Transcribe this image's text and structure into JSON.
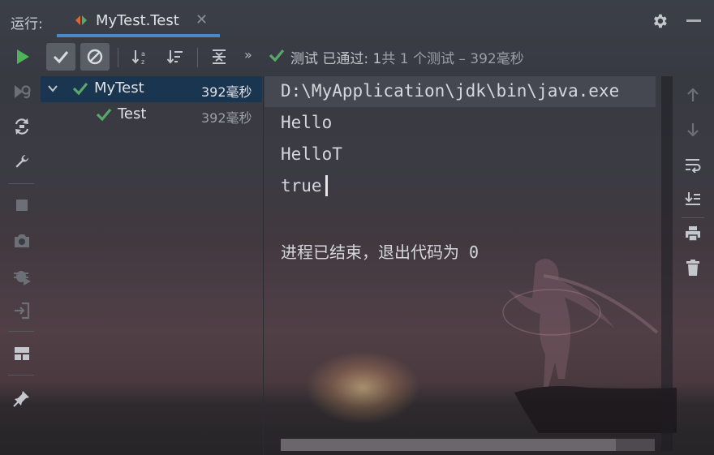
{
  "topbar": {
    "run_label": "运行:",
    "tab_title": "MyTest.Test",
    "tab_close": "✕",
    "icons": [
      "test-config-icon",
      "settings-icon",
      "minimize-icon"
    ]
  },
  "toolbar": {
    "more": "»",
    "status_main": "测试 已通过: 1",
    "status_sub": "共 1 个测试 – 392毫秒",
    "icons": [
      "run-icon",
      "show-passed-icon",
      "show-ignored-icon",
      "sort-alpha-icon",
      "sort-duration-icon",
      "expand-all-icon"
    ]
  },
  "left_strip": {
    "icons": [
      "rerun-failed-icon",
      "toggle-auto-test-icon",
      "wrench-icon",
      "stop-icon",
      "camera-icon",
      "debug-icon",
      "exit-icon",
      "layout-icon",
      "pin-icon"
    ]
  },
  "tree": {
    "items": [
      {
        "label": "MyTest",
        "time": "392毫秒",
        "status": "passed",
        "expanded": true
      },
      {
        "label": "Test",
        "time": "392毫秒",
        "status": "passed"
      }
    ]
  },
  "console": {
    "lines": [
      "D:\\MyApplication\\jdk\\bin\\java.exe",
      "Hello",
      "HelloT",
      "true",
      "",
      "进程已结束，退出代码为 0"
    ]
  },
  "right_strip": {
    "icons": [
      "scroll-up-icon",
      "scroll-down-icon",
      "soft-wrap-icon",
      "scroll-to-end-icon",
      "print-icon",
      "clear-icon"
    ]
  },
  "colors": {
    "accent": "#4a88c7",
    "pass_green": "#59a869",
    "run_green": "#4fb35c",
    "selection": "#123454"
  }
}
